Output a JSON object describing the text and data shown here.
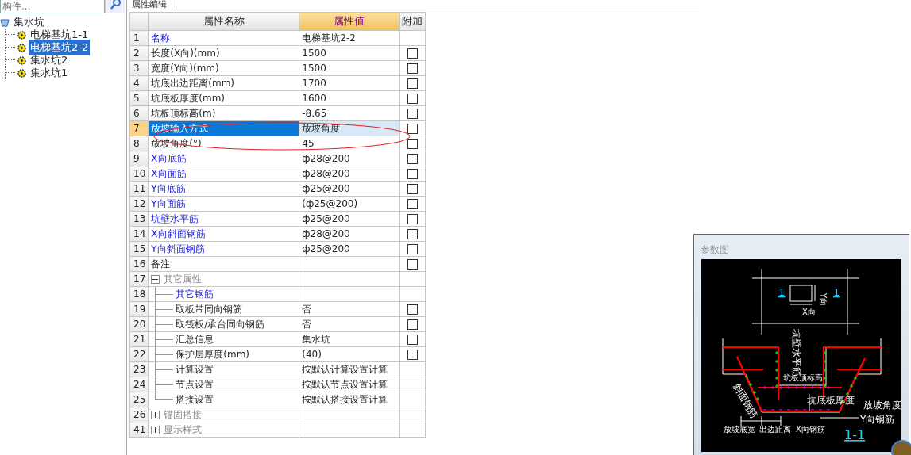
{
  "search": {
    "placeholder": "构件..."
  },
  "tab": {
    "label": "属性编辑"
  },
  "tree": {
    "root": "集水坑",
    "children": [
      {
        "label": "电梯基坑1-1",
        "selected": false
      },
      {
        "label": "电梯基坑2-2",
        "selected": true
      },
      {
        "label": "集水坑2",
        "selected": false
      },
      {
        "label": "集水坑1",
        "selected": false
      }
    ]
  },
  "table": {
    "columns": [
      "属性名称",
      "属性值",
      "附加"
    ],
    "rows": [
      {
        "number": "1",
        "name": "名称",
        "value": "电梯基坑2-2",
        "kind": "rebar",
        "selected": false
      },
      {
        "number": "2",
        "name": "长度(X向)(mm)",
        "value": "1500",
        "kind": "normal",
        "selected": false,
        "checked": false
      },
      {
        "number": "3",
        "name": "宽度(Y向)(mm)",
        "value": "1500",
        "kind": "normal",
        "selected": false,
        "checked": false
      },
      {
        "number": "4",
        "name": "坑底出边距离(mm)",
        "value": "1700",
        "kind": "normal",
        "selected": false,
        "checked": false
      },
      {
        "number": "5",
        "name": "坑底板厚度(mm)",
        "value": "1600",
        "kind": "normal",
        "selected": false,
        "checked": false
      },
      {
        "number": "6",
        "name": "坑板顶标高(m)",
        "value": "-8.65",
        "kind": "normal",
        "selected": false,
        "checked": false
      },
      {
        "number": "7",
        "name": "放坡输入方式",
        "value": "放坡角度",
        "kind": "normal",
        "selected": true,
        "checked": false
      },
      {
        "number": "8",
        "name": "放坡角度(°)",
        "value": "45",
        "kind": "normal",
        "selected": false,
        "checked": false
      },
      {
        "number": "9",
        "name": "X向底筋",
        "value": "ф28@200",
        "kind": "rebar",
        "selected": false,
        "checked": false
      },
      {
        "number": "10",
        "name": "X向面筋",
        "value": "ф28@200",
        "kind": "rebar",
        "selected": false,
        "checked": false
      },
      {
        "number": "11",
        "name": "Y向底筋",
        "value": "ф25@200",
        "kind": "rebar",
        "selected": false,
        "checked": false
      },
      {
        "number": "12",
        "name": "Y向面筋",
        "value": "(ф25@200)",
        "kind": "rebar",
        "selected": false,
        "checked": false
      },
      {
        "number": "13",
        "name": "坑壁水平筋",
        "value": "ф25@200",
        "kind": "rebar",
        "selected": false,
        "checked": false
      },
      {
        "number": "14",
        "name": "X向斜面钢筋",
        "value": "ф28@200",
        "kind": "rebar",
        "selected": false,
        "checked": false
      },
      {
        "number": "15",
        "name": "Y向斜面钢筋",
        "value": "ф25@200",
        "kind": "rebar",
        "selected": false,
        "checked": false
      },
      {
        "number": "16",
        "name": "备注",
        "kind": "normal",
        "selected": false,
        "checked": false
      },
      {
        "number": "17",
        "name": "其它属性",
        "kind": "group",
        "expanded": true,
        "selected": false
      },
      {
        "number": "18",
        "name": "其它钢筋",
        "kind": "sub_rebar",
        "selected": false
      },
      {
        "number": "19",
        "name": "取板带同向钢筋",
        "value": "否",
        "kind": "sub",
        "selected": false,
        "checked": false
      },
      {
        "number": "20",
        "name": "取筏板/承台同向钢筋",
        "value": "否",
        "kind": "sub",
        "selected": false,
        "checked": false
      },
      {
        "number": "21",
        "name": "汇总信息",
        "value": "集水坑",
        "kind": "sub",
        "selected": false,
        "checked": false
      },
      {
        "number": "22",
        "name": "保护层厚度(mm)",
        "value": "(40)",
        "kind": "sub",
        "selected": false,
        "checked": false
      },
      {
        "number": "23",
        "name": "计算设置",
        "value": "按默认计算设置计算",
        "kind": "sub",
        "selected": false
      },
      {
        "number": "24",
        "name": "节点设置",
        "value": "按默认节点设置计算",
        "kind": "sub",
        "selected": false
      },
      {
        "number": "25",
        "name": "搭接设置",
        "value": "按默认搭接设置计算",
        "kind": "sub_last",
        "selected": false
      },
      {
        "number": "26",
        "name": "锚固搭接",
        "kind": "group",
        "expanded": false,
        "selected": false
      },
      {
        "number": "41",
        "name": "显示样式",
        "kind": "group",
        "expanded": false,
        "selected": false
      }
    ]
  },
  "diagram": {
    "title": "参数图",
    "labels": [
      "1",
      "1",
      "Y向",
      "X向",
      "坑壁水平筋",
      "坑板顶标高",
      "斜面钢筋",
      "坑底板厚度",
      "放坡角度",
      "Y向钢筋",
      "放坡底宽",
      "出边距离",
      "X向钢筋",
      "1-1"
    ]
  }
}
